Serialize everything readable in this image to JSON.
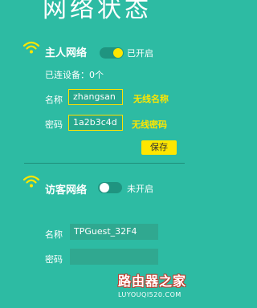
{
  "page": {
    "title": "网络状态"
  },
  "host_network": {
    "title": "主人网络",
    "toggle_state": "on",
    "toggle_label": "已开启",
    "connected_devices": "已连设备：0个",
    "name_label": "名称",
    "name_value": "zhangsan",
    "name_hint": "无线名称",
    "password_label": "密码",
    "password_value": "1a2b3c4d",
    "password_hint": "无线密码",
    "save_label": "保存"
  },
  "guest_network": {
    "title": "访客网络",
    "toggle_state": "off",
    "toggle_label": "未开启",
    "name_label": "名称",
    "name_value": "TPGuest_32F4",
    "password_label": "密码",
    "password_value": ""
  },
  "watermark": {
    "main": "路由器之家",
    "sub": "LUYOUQI520.COM"
  },
  "colors": {
    "background": "#2dbba3",
    "accent": "#ffe600",
    "toggle_on": "#ffe600",
    "toggle_off": "#ffffff"
  },
  "icons": {
    "host": "wifi-icon",
    "guest": "wifi-icon"
  }
}
